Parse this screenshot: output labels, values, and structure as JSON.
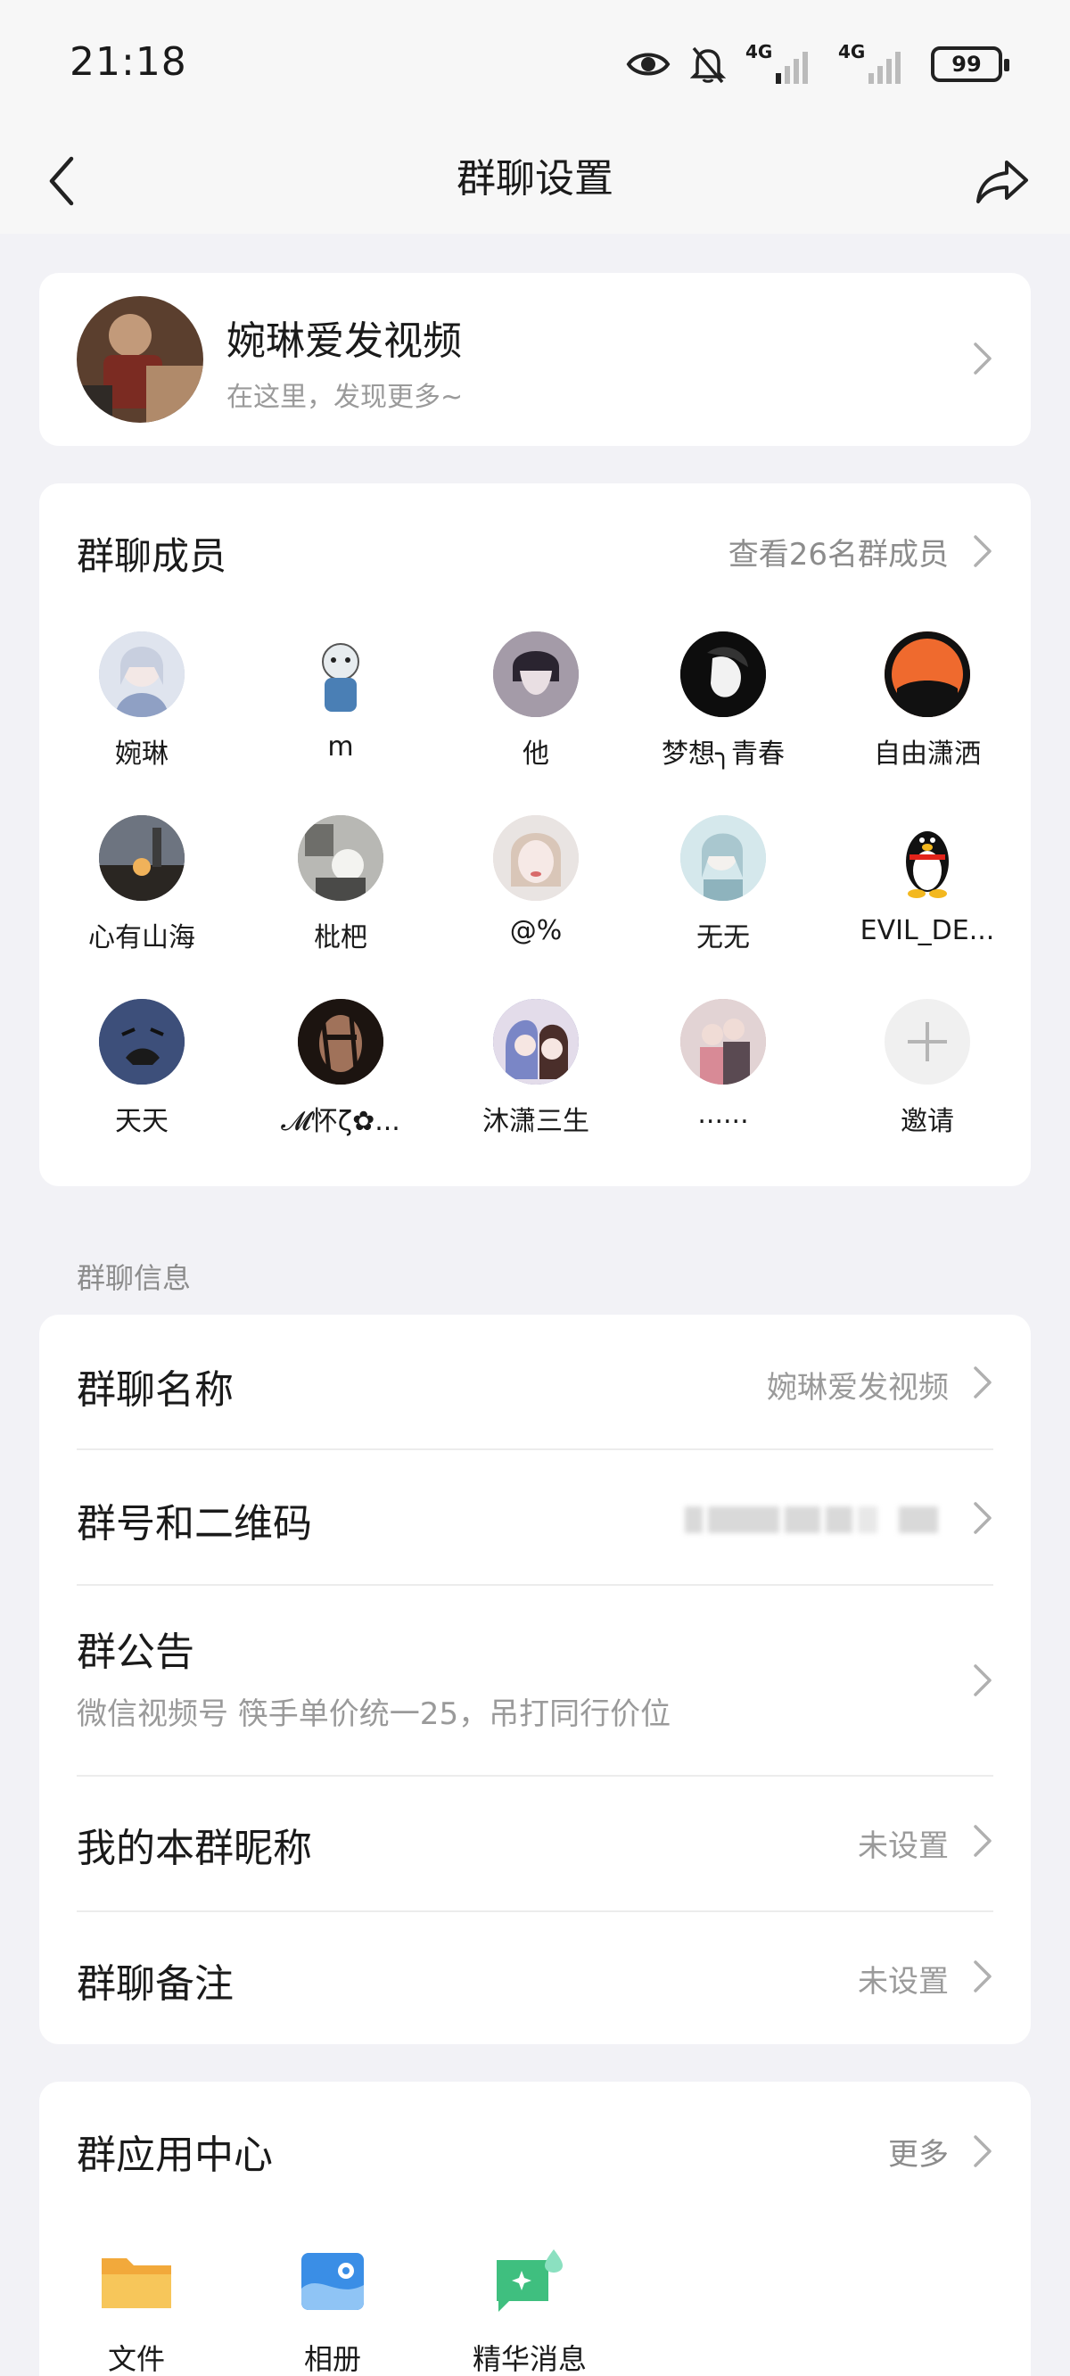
{
  "status_bar": {
    "time": "21:18",
    "network1": "4G",
    "network2": "4G",
    "battery": "99",
    "icons": [
      "eye-icon",
      "bell-muted-icon",
      "signal-icon",
      "battery-icon"
    ]
  },
  "navbar": {
    "title": "群聊设置",
    "back_icon": "chevron-left-icon",
    "share_icon": "share-icon"
  },
  "profile": {
    "name": "婉琳爱发视频",
    "subtitle": "在这里，发现更多~"
  },
  "members": {
    "title": "群聊成员",
    "view_all": "查看26名群成员",
    "items": [
      {
        "name": "婉琳",
        "color": "#b9c4d9"
      },
      {
        "name": "m",
        "color": "#e9eef2"
      },
      {
        "name": "他",
        "color": "#8f8494"
      },
      {
        "name": "梦想╮青春",
        "color": "#111111"
      },
      {
        "name": "自由潇洒",
        "color": "#ef6a2e"
      },
      {
        "name": "心有山海",
        "color": "#3b3a38"
      },
      {
        "name": "枇杷",
        "color": "#9a9a96"
      },
      {
        "name": "@%",
        "color": "#e6d7d4"
      },
      {
        "name": "无无",
        "color": "#c7dde3"
      },
      {
        "name": "EVIL_DE...",
        "color": "#ffffff"
      },
      {
        "name": "天天",
        "color": "#3d4f7a"
      },
      {
        "name": "𝓜怀ζ✿...",
        "color": "#3a2a22"
      },
      {
        "name": "沐潇三生",
        "color": "#6a6fa8"
      },
      {
        "name": "......",
        "color": "#cfa9a8"
      },
      {
        "name": "邀请",
        "color": "#f0f0f0"
      }
    ]
  },
  "section_info_label": "群聊信息",
  "info": {
    "group_name_label": "群聊名称",
    "group_name_value": "婉琳爱发视频",
    "group_id_label": "群号和二维码",
    "notice_label": "群公告",
    "notice_text": "微信视频号 筷手单价统一25，吊打同行价位",
    "nickname_label": "我的本群昵称",
    "nickname_value": "未设置",
    "remark_label": "群聊备注",
    "remark_value": "未设置"
  },
  "apps": {
    "title": "群应用中心",
    "more": "更多",
    "items": [
      {
        "name": "文件",
        "icon": "folder-icon",
        "color": "#f5b73b"
      },
      {
        "name": "相册",
        "icon": "album-icon",
        "color": "#3a8ee6"
      },
      {
        "name": "精华消息",
        "icon": "highlight-icon",
        "color": "#3fbf7f"
      }
    ]
  },
  "colors": {
    "background": "#f2f2f6",
    "card": "#ffffff",
    "secondary_text": "#9a9a9a"
  }
}
